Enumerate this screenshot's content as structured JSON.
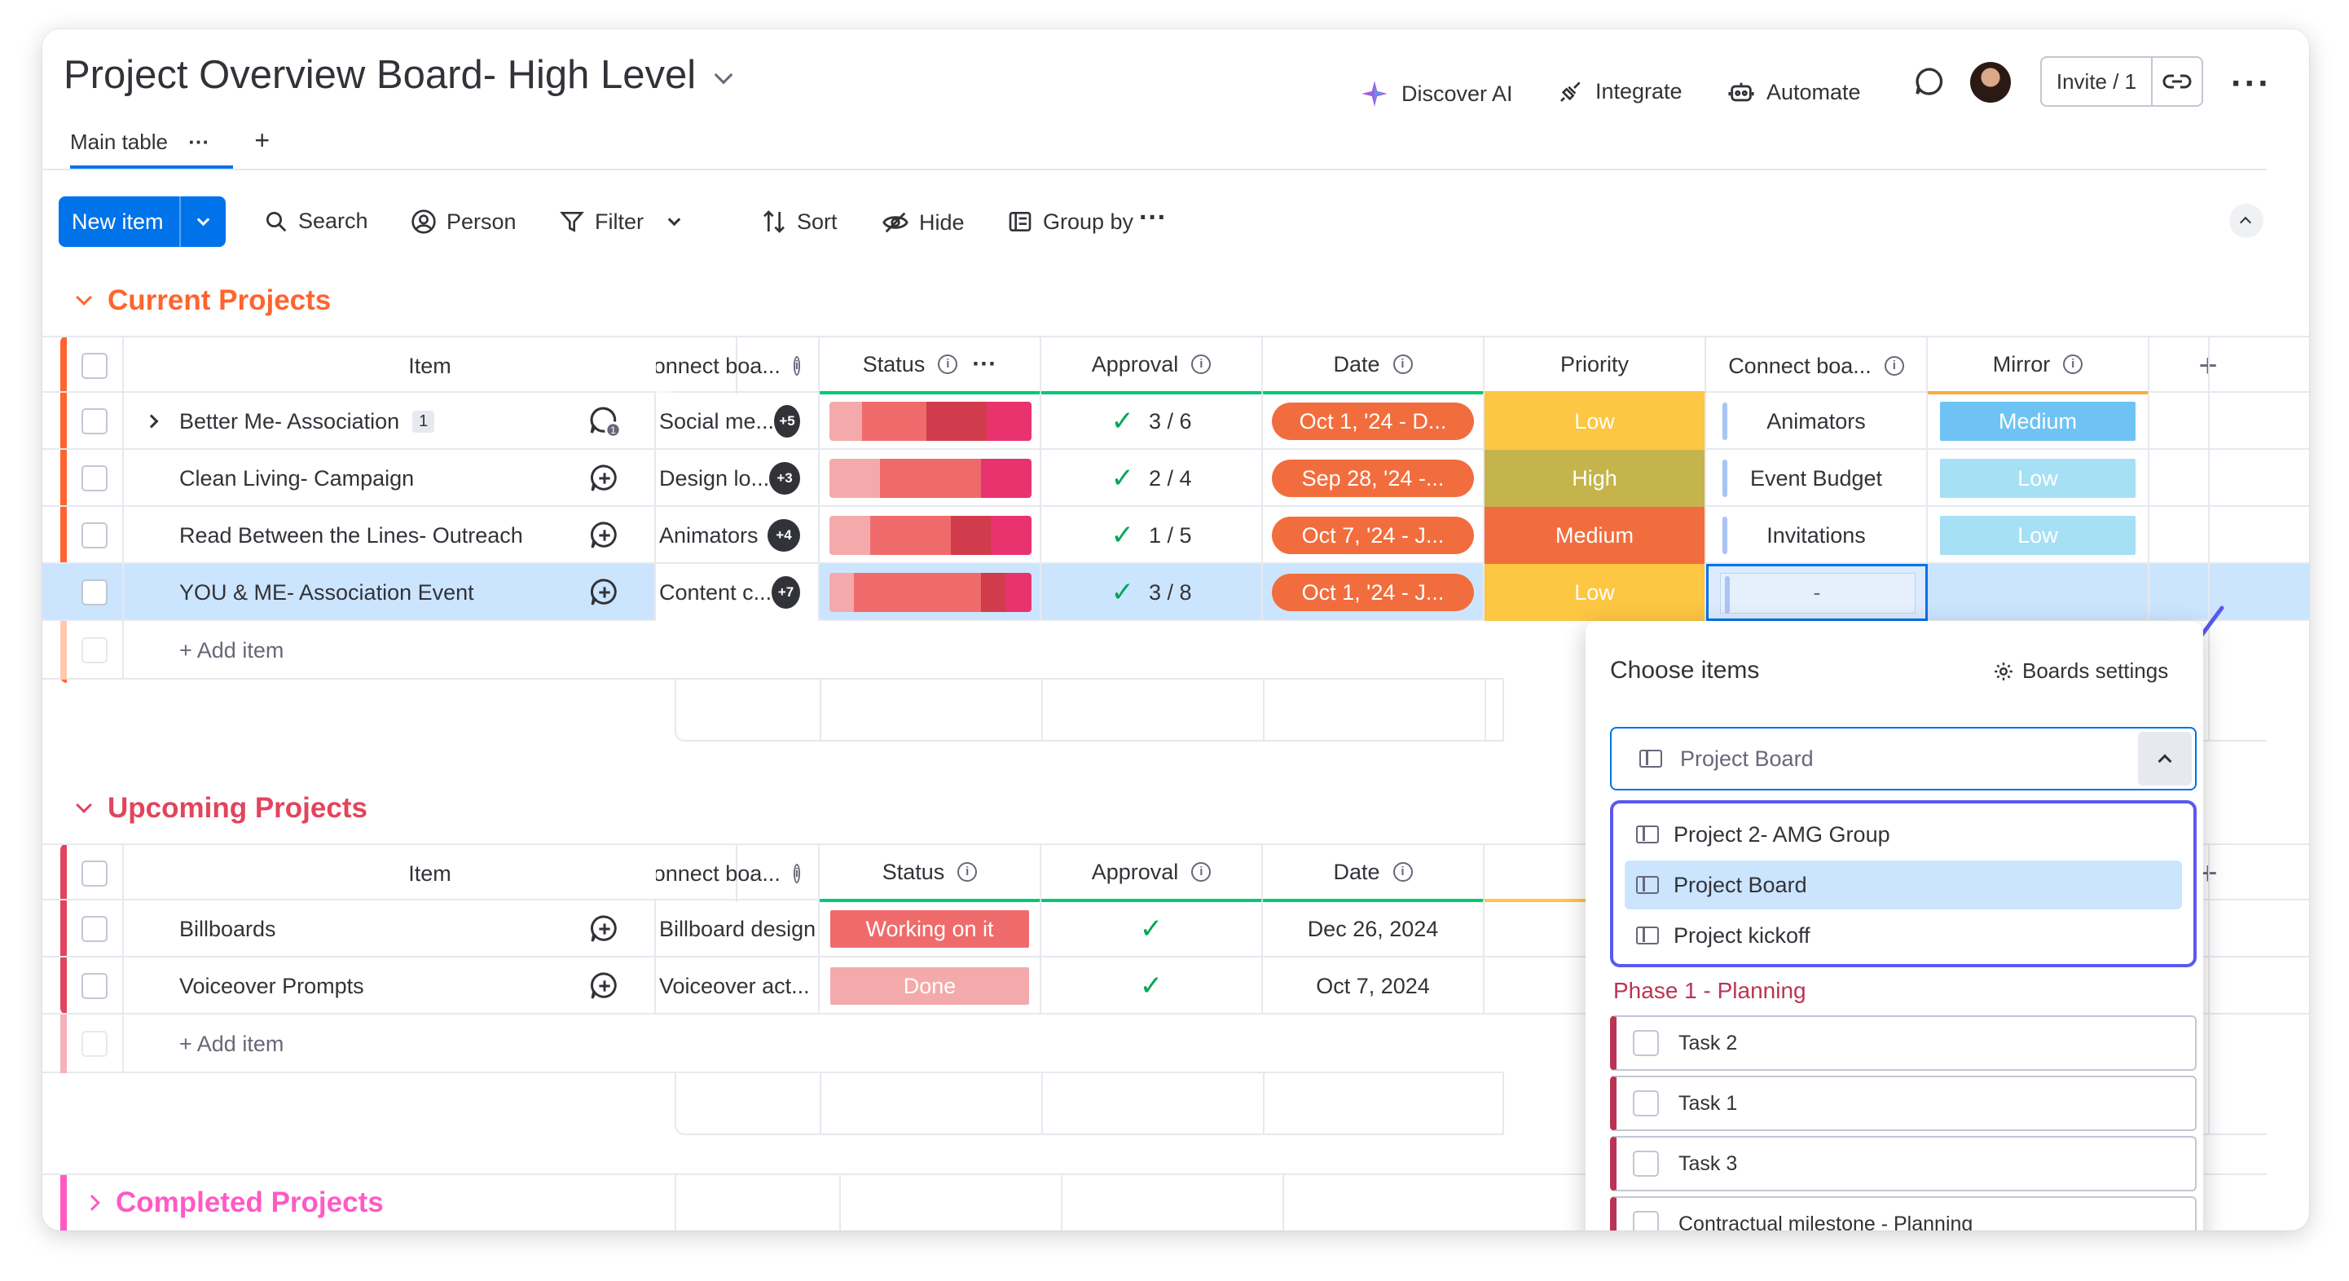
{
  "header": {
    "title": "Project Overview Board- High Level",
    "discover_ai": "Discover AI",
    "integrate": "Integrate",
    "automate": "Automate",
    "invite": "Invite / 1"
  },
  "tabs": {
    "main": "Main table",
    "more": "···",
    "add": "+"
  },
  "toolbar": {
    "new_item": "New item",
    "search": "Search",
    "person": "Person",
    "filter": "Filter",
    "sort": "Sort",
    "hide": "Hide",
    "group_by": "Group by",
    "more": "···"
  },
  "groups": {
    "current": {
      "title": "Current Projects",
      "color": "#ff642e",
      "columns": {
        "item": "Item",
        "connect": "Connect boa...",
        "status": "Status",
        "approval": "Approval",
        "date": "Date",
        "priority": "Priority",
        "connect2": "Connect boa...",
        "mirror": "Mirror"
      },
      "rows": [
        {
          "name": "Better Me- Association",
          "count": "1",
          "connect": "Social me...",
          "badge": "+5",
          "approval": "3 / 6",
          "date": "Oct 1, '24 - D...",
          "priority": "Low",
          "connect2": "Animators",
          "mirror": "Medium"
        },
        {
          "name": "Clean Living- Campaign",
          "connect": "Design lo...",
          "badge": "+3",
          "approval": "2 / 4",
          "date": "Sep 28, '24 -...",
          "priority": "High",
          "connect2": "Event Budget",
          "mirror": "Low"
        },
        {
          "name": "Read Between the Lines- Outreach",
          "connect": "Animators",
          "badge": "+4",
          "approval": "1 / 5",
          "date": "Oct 7, '24 - J...",
          "priority": "Medium",
          "connect2": "Invitations",
          "mirror": "Low"
        },
        {
          "name": "YOU & ME- Association Event",
          "connect": "Content c...",
          "badge": "+7",
          "approval": "3 / 8",
          "date": "Oct 1, '24 - J...",
          "priority": "Low",
          "connect2": "-",
          "mirror": ""
        }
      ],
      "add_item": "+ Add item"
    },
    "upcoming": {
      "title": "Upcoming Projects",
      "color": "#e2445c",
      "columns": {
        "item": "Item",
        "connect": "Connect boa...",
        "status": "Status",
        "approval": "Approval",
        "date": "Date"
      },
      "rows": [
        {
          "name": "Billboards",
          "connect": "Billboard design",
          "status": "Working on it",
          "date": "Dec 26, 2024"
        },
        {
          "name": "Voiceover Prompts",
          "connect": "Voiceover act...",
          "status": "Done",
          "date": "Oct 7, 2024"
        }
      ],
      "add_item": "+ Add item"
    },
    "completed": {
      "title": "Completed Projects",
      "color": "#ff5ac4"
    }
  },
  "panel": {
    "title": "Choose items",
    "settings": "Boards settings",
    "select_value": "Project Board",
    "options": [
      "Project 2- AMG Group",
      "Project Board",
      "Project kickoff"
    ],
    "group_title": "Phase 1 - Planning",
    "tasks": [
      "Task 2",
      "Task 1",
      "Task 3",
      "Contractual milestone - Planning"
    ]
  },
  "colors": {
    "accent": "#0073ea",
    "low": "#fdc643",
    "high": "#c5b44b",
    "medium": "#f26d3d",
    "date": "#f26d3d",
    "working": "#ef6b6b",
    "done": "#f4aaaa",
    "mirror_medium": "#6ec3f4",
    "mirror_low": "#a6e0f5",
    "highlight_arrow": "#5b58f0"
  }
}
